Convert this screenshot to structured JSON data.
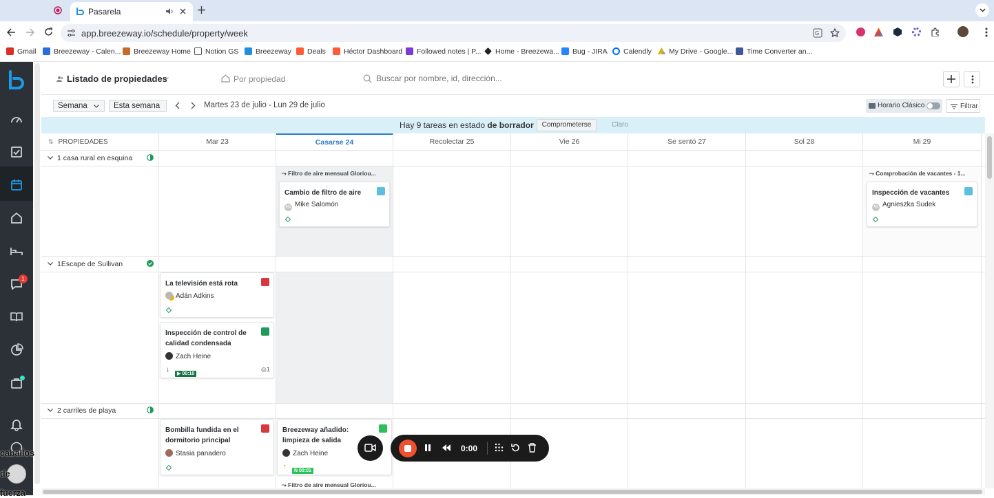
{
  "browser": {
    "tabs": [
      {
        "title": ""
      },
      {
        "title": "Pasarela"
      }
    ],
    "url": "app.breezeway.io/schedule/property/week",
    "bookmarks": [
      {
        "label": "Gmail",
        "icon": "gmail-icon",
        "color": "#d93025"
      },
      {
        "label": "Breezeway - Calen...",
        "icon": "calendar-icon",
        "color": "#2d6cdf"
      },
      {
        "label": "Breezeway Home",
        "icon": "house-icon",
        "color": "#c46a2b"
      },
      {
        "label": "Notion GS",
        "icon": "folder-icon",
        "color": "#555555"
      },
      {
        "label": "Breezeway",
        "icon": "breezeway-logo-icon",
        "color": "#1c8fe0"
      },
      {
        "label": "Deals",
        "icon": "hubspot-icon",
        "color": "#ff5c35"
      },
      {
        "label": "Héctor Dashboard",
        "icon": "hubspot-icon",
        "color": "#ff5c35"
      },
      {
        "label": "Followed notes | P...",
        "icon": "gong-icon",
        "color": "#7a3bd9"
      },
      {
        "label": "Home - Breezewa...",
        "icon": "diamond-icon",
        "color": "#222222"
      },
      {
        "label": "Bug - JIRA",
        "icon": "jira-icon",
        "color": "#2684ff"
      },
      {
        "label": "Calendly",
        "icon": "calendly-icon",
        "color": "#006bff"
      },
      {
        "label": "My Drive - Google...",
        "icon": "drive-icon",
        "color": "#0f9d58"
      },
      {
        "label": "Time Converter an...",
        "icon": "clock-icon",
        "color": "#3b5998"
      }
    ]
  },
  "header": {
    "title": "Listado de propiedades",
    "view_by": "Por propiedad",
    "search_placeholder": "Buscar por nombre, id, dirección..."
  },
  "toolbar": {
    "range_select": "Semana",
    "this_week": "Esta semana",
    "date_range": "Martes 23 de julio - Lun 29 de julio",
    "classic_toggle": "Horario Clásico",
    "filter": "Filtrar"
  },
  "draft_banner": {
    "text": "Hay 9 tareas en estado",
    "bold": "de borrador",
    "commit": "Comprometerse",
    "clear": "Claro"
  },
  "grid": {
    "properties_header": "PROPIEDADES",
    "days": [
      "Mar 23",
      "Casarse 24",
      "Recolectar 25",
      "Vie 26",
      "Se sentó 27",
      "Sol 28",
      "Mi 29"
    ],
    "today_index": 1,
    "properties": [
      {
        "name": "1 casa rural en esquina",
        "status": "partial"
      },
      {
        "name": "1Escape de Sullivan",
        "status": "complete"
      },
      {
        "name": "2 carriles de playa",
        "status": "partial"
      }
    ],
    "groups": [
      "Filtro de aire mensual Gloriou...",
      "Comprobación de vacantes - 1...",
      "Filtro de aire mensual Gloriou..."
    ],
    "cards": [
      {
        "title": "Cambio de filtro de aire",
        "person": "Mike Salomón",
        "initials": "MS",
        "badge_color": "#5bc0de"
      },
      {
        "title": "Inspección de vacantes",
        "person": "Agnieszka Sudek",
        "initials": "AS",
        "badge_color": "#5bc0de"
      },
      {
        "title": "La televisión está rota",
        "person": "Adán Adkins",
        "badge_color": "#d9363e"
      },
      {
        "title": "Inspección de control de calidad condensada",
        "person": "Zach Heine",
        "timer": "00:10",
        "comments": "1",
        "badge_color": "#1e9a5b"
      },
      {
        "title": "Bombilla fundida en el dormitorio principal",
        "person": "Stasia panadero",
        "badge_color": "#d9363e"
      },
      {
        "title": "Breezeway añadido: limpieza de salida",
        "person": "Zach Heine",
        "timer": "00:01",
        "badge_color": "#2bc15a"
      }
    ]
  },
  "sidebar": {
    "chat_badge": "1"
  },
  "recorder": {
    "time": "0:00"
  },
  "watermark": [
    "caballos",
    "de",
    "fuerza"
  ]
}
